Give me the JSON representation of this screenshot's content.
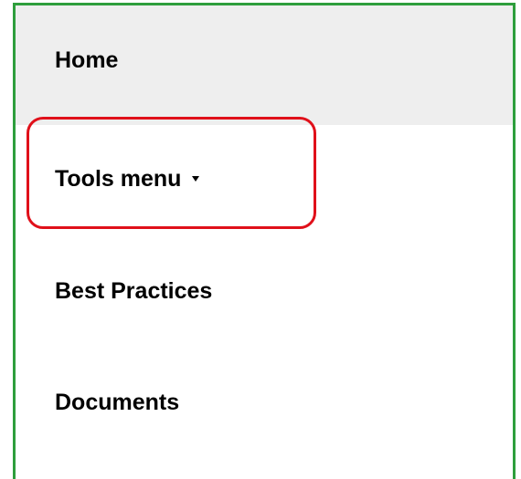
{
  "nav": {
    "items": [
      {
        "label": "Home",
        "state": "active"
      },
      {
        "label": "Tools menu",
        "has_dropdown": true
      },
      {
        "label": "Best Practices"
      },
      {
        "label": "Documents"
      }
    ]
  },
  "annotation": {
    "highlight_target": "Tools menu",
    "highlight_color": "#e0101a",
    "frame_color": "#2e9e3c"
  },
  "colors": {
    "active_item_background": "#eeeeee",
    "text": "#000000"
  }
}
